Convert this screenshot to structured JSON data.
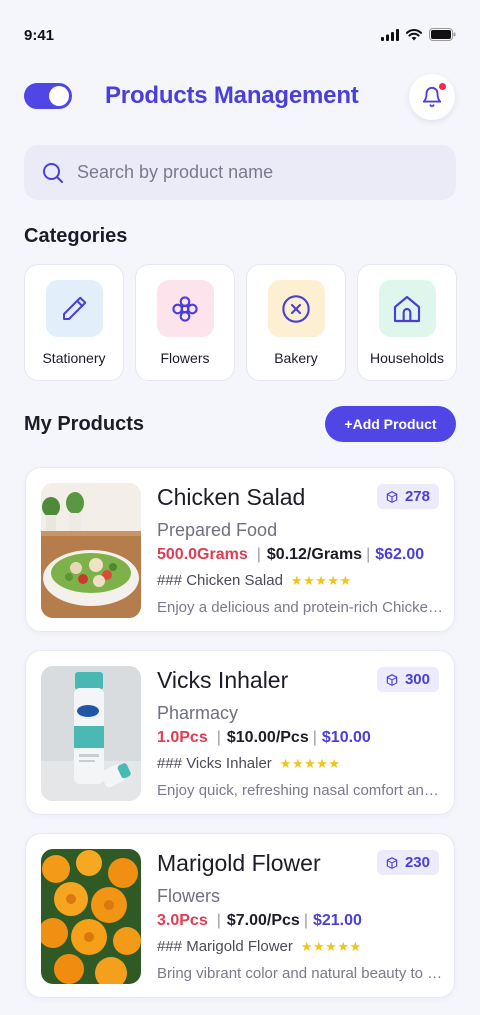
{
  "status": {
    "time": "9:41"
  },
  "header": {
    "title": "Products Management"
  },
  "search": {
    "placeholder": "Search by product name"
  },
  "categories_section": {
    "title": "Categories",
    "items": [
      {
        "label": "Stationery",
        "icon": "pencil-icon",
        "bg": "#e3eefb",
        "color": "#4a3fd8"
      },
      {
        "label": "Flowers",
        "icon": "flower-icon",
        "bg": "#fde4ec",
        "color": "#4a3fd8"
      },
      {
        "label": "Bakery",
        "icon": "circle-x-icon",
        "bg": "#fdf0d2",
        "color": "#4a3fd8"
      },
      {
        "label": "Households",
        "icon": "home-icon",
        "bg": "#def6ec",
        "color": "#4a3fd8"
      }
    ]
  },
  "products_section": {
    "title": "My Products",
    "add_label": "+Add Product",
    "items": [
      {
        "name": "Chicken Salad",
        "stock": "278",
        "category": "Prepared Food",
        "qty": "500.0Grams",
        "unit_price": "$0.12/Grams",
        "total": "$62.00",
        "title_line": "### Chicken Salad",
        "stars": "★★★★★",
        "desc": "Enjoy a delicious and protein-rich Chicken Salad"
      },
      {
        "name": "Vicks Inhaler",
        "stock": "300",
        "category": "Pharmacy",
        "qty": "1.0Pcs",
        "unit_price": "$10.00/Pcs",
        "total": "$10.00",
        "title_line": "### Vicks Inhaler",
        "stars": "★★★★★",
        "desc": "Enjoy quick, refreshing nasal comfort anywhere"
      },
      {
        "name": "Marigold Flower",
        "stock": "230",
        "category": "Flowers",
        "qty": "3.0Pcs",
        "unit_price": "$7.00/Pcs",
        "total": "$21.00",
        "title_line": "### Marigold Flower",
        "stars": "★★★★★",
        "desc": "Bring vibrant color and natural beauty to your home"
      }
    ]
  },
  "colors": {
    "accent": "#4f46e5",
    "price_red": "#e23c52",
    "background": "#f5f5fc"
  }
}
